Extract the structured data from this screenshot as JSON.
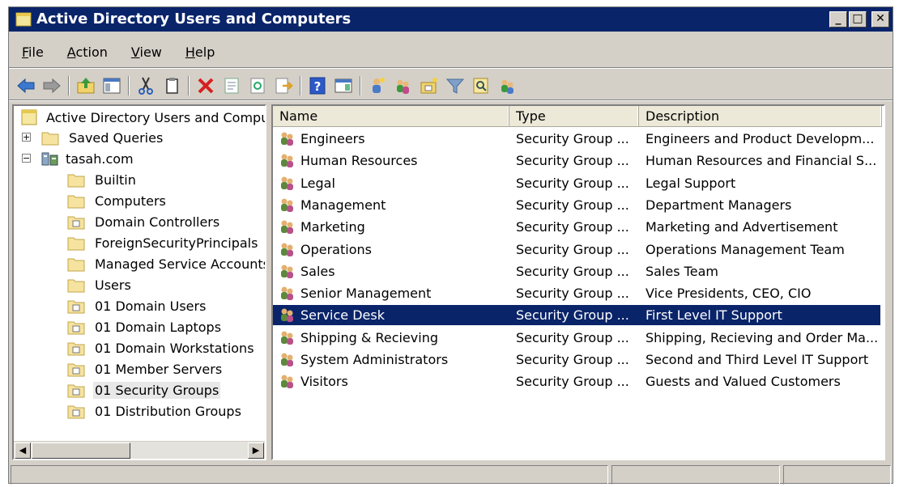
{
  "window": {
    "title": "Active Directory Users and Computers"
  },
  "window_controls": {
    "minimize": "_",
    "maximize": "□",
    "close": "✕"
  },
  "menu": [
    {
      "label": "File",
      "accel": "F",
      "rest": "ile"
    },
    {
      "label": "Action",
      "accel": "A",
      "rest": "ction"
    },
    {
      "label": "View",
      "accel": "V",
      "rest": "iew"
    },
    {
      "label": "Help",
      "accel": "H",
      "rest": "elp"
    }
  ],
  "toolbar_icons": [
    "back-icon",
    "forward-icon",
    "up-folder-icon",
    "show-console-tree-icon",
    "cut-icon",
    "copy-icon",
    "delete-icon",
    "properties-icon",
    "refresh-icon",
    "export-list-icon",
    "help-icon",
    "action-pane-icon",
    "new-user-icon",
    "new-group-icon",
    "new-ou-icon",
    "filter-icon",
    "find-icon",
    "add-to-group-icon"
  ],
  "tree": {
    "root": "Active Directory Users and Comput",
    "saved_queries": "Saved Queries",
    "domain": "tasah.com",
    "children": [
      "Builtin",
      "Computers",
      "Domain Controllers",
      "ForeignSecurityPrincipals",
      "Managed Service Accounts",
      "Users",
      "01 Domain Users",
      "01 Domain Laptops",
      "01 Domain Workstations",
      "01 Member Servers",
      "01 Security Groups",
      "01 Distribution Groups"
    ],
    "selected": "01 Security Groups"
  },
  "list": {
    "columns": [
      "Name",
      "Type",
      "Description"
    ],
    "rows": [
      {
        "name": "Engineers",
        "type": "Security Group ...",
        "description": "Engineers and Product Developm..."
      },
      {
        "name": "Human Resources",
        "type": "Security Group ...",
        "description": "Human Resources and Financial S..."
      },
      {
        "name": "Legal",
        "type": "Security Group ...",
        "description": "Legal Support"
      },
      {
        "name": "Management",
        "type": "Security Group ...",
        "description": "Department Managers"
      },
      {
        "name": "Marketing",
        "type": "Security Group ...",
        "description": "Marketing and Advertisement"
      },
      {
        "name": "Operations",
        "type": "Security Group ...",
        "description": "Operations Management Team"
      },
      {
        "name": "Sales",
        "type": "Security Group ...",
        "description": "Sales Team"
      },
      {
        "name": "Senior Management",
        "type": "Security Group ...",
        "description": "Vice Presidents, CEO, CIO"
      },
      {
        "name": "Service Desk",
        "type": "Security Group ...",
        "description": "First Level IT Support"
      },
      {
        "name": "Shipping & Recieving",
        "type": "Security Group ...",
        "description": "Shipping, Recieving and Order Ma..."
      },
      {
        "name": "System Administrators",
        "type": "Security Group ...",
        "description": "Second and Third Level IT Support"
      },
      {
        "name": "Visitors",
        "type": "Security Group ...",
        "description": "Guests and Valued Customers"
      }
    ],
    "selected": "Service Desk"
  },
  "colors": {
    "titlebar": "#0a246a",
    "selection": "#0a246a",
    "chrome": "#d4d0c8"
  }
}
